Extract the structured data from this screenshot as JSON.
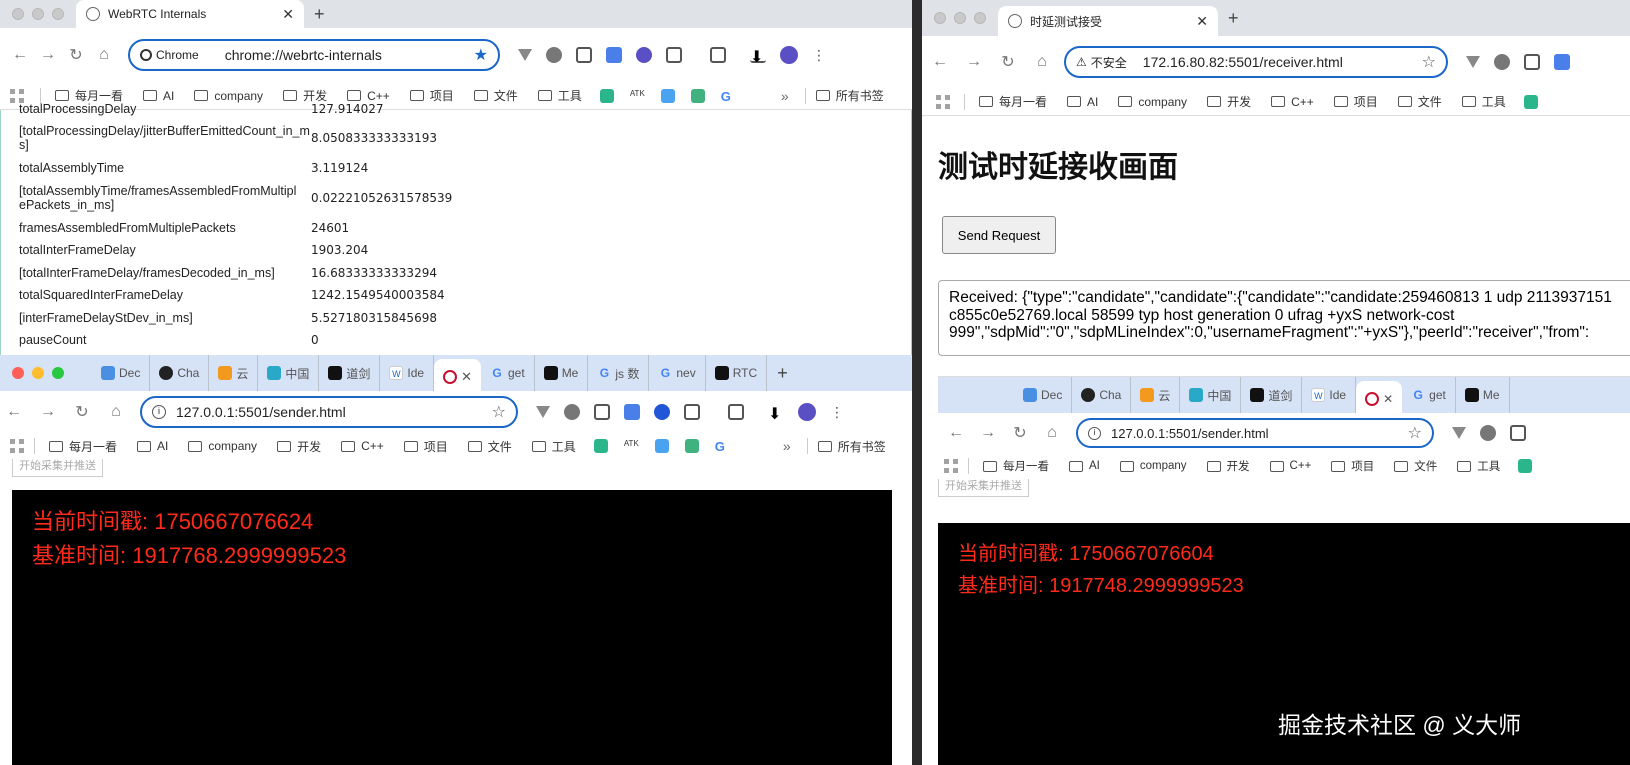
{
  "win1": {
    "tab_title": "WebRTC Internals",
    "chip": "Chrome",
    "url": "chrome://webrtc-internals",
    "bookmarks": [
      "每月一看",
      "AI",
      "company",
      "开发",
      "C++",
      "项目",
      "文件",
      "工具"
    ],
    "bm_more": "»",
    "bm_all": "所有书签",
    "stats": [
      {
        "k": "totalProcessingDelay",
        "v": "127.914027"
      },
      {
        "k": "[totalProcessingDelay/jitterBufferEmittedCount_in_ms]",
        "v": "8.050833333333193"
      },
      {
        "k": "totalAssemblyTime",
        "v": "3.119124"
      },
      {
        "k": "[totalAssemblyTime/framesAssembledFromMultiplePackets_in_ms]",
        "v": "0.02221052631578539"
      },
      {
        "k": "framesAssembledFromMultiplePackets",
        "v": "24601"
      },
      {
        "k": "totalInterFrameDelay",
        "v": "1903.204"
      },
      {
        "k": "[totalInterFrameDelay/framesDecoded_in_ms]",
        "v": "16.68333333333294"
      },
      {
        "k": "totalSquaredInterFrameDelay",
        "v": "1242.1549540003584"
      },
      {
        "k": "[interFrameDelayStDev_in_ms]",
        "v": "5.527180315845698"
      },
      {
        "k": "pauseCount",
        "v": "0"
      }
    ]
  },
  "win2": {
    "tabs": [
      "Dec",
      "Cha",
      "云",
      "中国",
      "道剑",
      "Ide",
      "",
      "get",
      "Me",
      "js 数",
      "nev",
      "RTC"
    ],
    "url": "127.0.0.1:5501/sender.html",
    "bookmarks": [
      "每月一看",
      "AI",
      "company",
      "开发",
      "C++",
      "项目",
      "文件",
      "工具"
    ],
    "bm_more": "»",
    "bm_all": "所有书签",
    "hidden_button": "开始采集并推送",
    "timestamp_line": "当前时间戳: 1750667076624",
    "base_line": "基准时间: 1917768.2999999523"
  },
  "win3": {
    "tab_title": "时延测试接受",
    "insecure": "不安全",
    "url": "172.16.80.82:5501/receiver.html",
    "bookmarks": [
      "每月一看",
      "AI",
      "company",
      "开发",
      "C++",
      "项目",
      "文件",
      "工具"
    ],
    "heading": "测试时延接收画面",
    "send_button": "Send Request",
    "received": [
      "Received: {\"type\":\"candidate\",\"candidate\":{\"candidate\":\"candidate:259460813 1 udp 2113937151",
      "c855c0e52769.local 58599 typ host generation 0 ufrag +yxS network-cost",
      "999\",\"sdpMid\":\"0\",\"sdpMLineIndex\":0,\"usernameFragment\":\"+yxS\"},\"peerId\":\"receiver\",\"from\":"
    ],
    "inner": {
      "tabs": [
        "Dec",
        "Cha",
        "云",
        "中国",
        "道剑",
        "Ide",
        "",
        "get",
        "Me"
      ],
      "url": "127.0.0.1:5501/sender.html",
      "bookmarks": [
        "每月一看",
        "AI",
        "company",
        "开发",
        "C++",
        "项目",
        "文件",
        "工具"
      ],
      "hidden_button": "开始采集并推送",
      "timestamp_line": "当前时间戳: 1750667076604",
      "base_line": "基准时间: 1917748.2999999523"
    },
    "watermark": "掘金技术社区 @ 义大师"
  },
  "colors": {
    "accent": "#1a66c9",
    "video_text": "#ff2a1a",
    "tab_strip": "#dfe3e7"
  }
}
